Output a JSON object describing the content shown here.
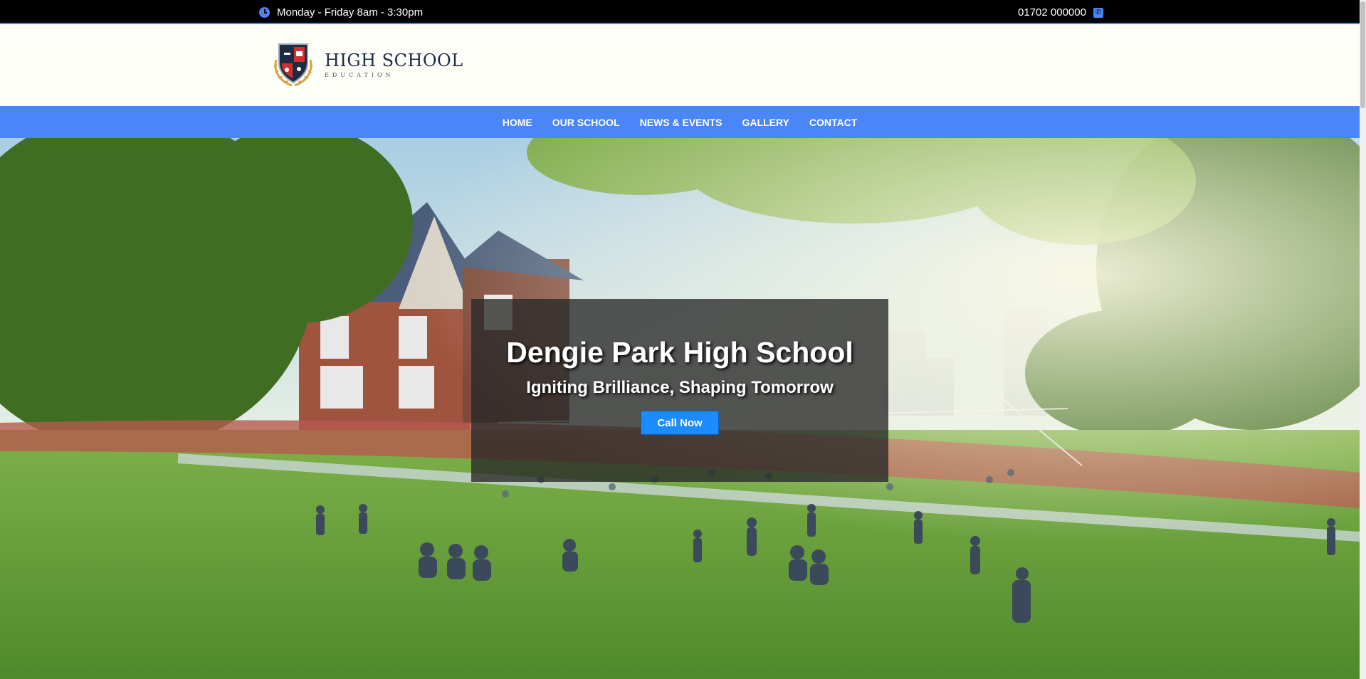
{
  "topbar": {
    "hours": "Monday - Friday 8am - 3:30pm",
    "hours_icon": "clock-icon",
    "phone": "01702 000000",
    "phone_icon": "phone-icon"
  },
  "header": {
    "logo_title": "HIGH SCHOOL",
    "logo_subtitle": "EDUCATION",
    "logo_icon": "school-crest-icon"
  },
  "nav": {
    "items": [
      {
        "label": "HOME"
      },
      {
        "label": "OUR SCHOOL"
      },
      {
        "label": "NEWS & EVENTS"
      },
      {
        "label": "GALLERY"
      },
      {
        "label": "CONTACT"
      }
    ]
  },
  "hero": {
    "title": "Dengie Park High School",
    "subtitle": "Igniting Brilliance, Shaping Tomorrow",
    "cta_label": "Call Now"
  },
  "colors": {
    "accent": "#4a86f7",
    "cta": "#1a8cff",
    "topbar_bg": "#000000",
    "header_bg": "#fefef9"
  }
}
